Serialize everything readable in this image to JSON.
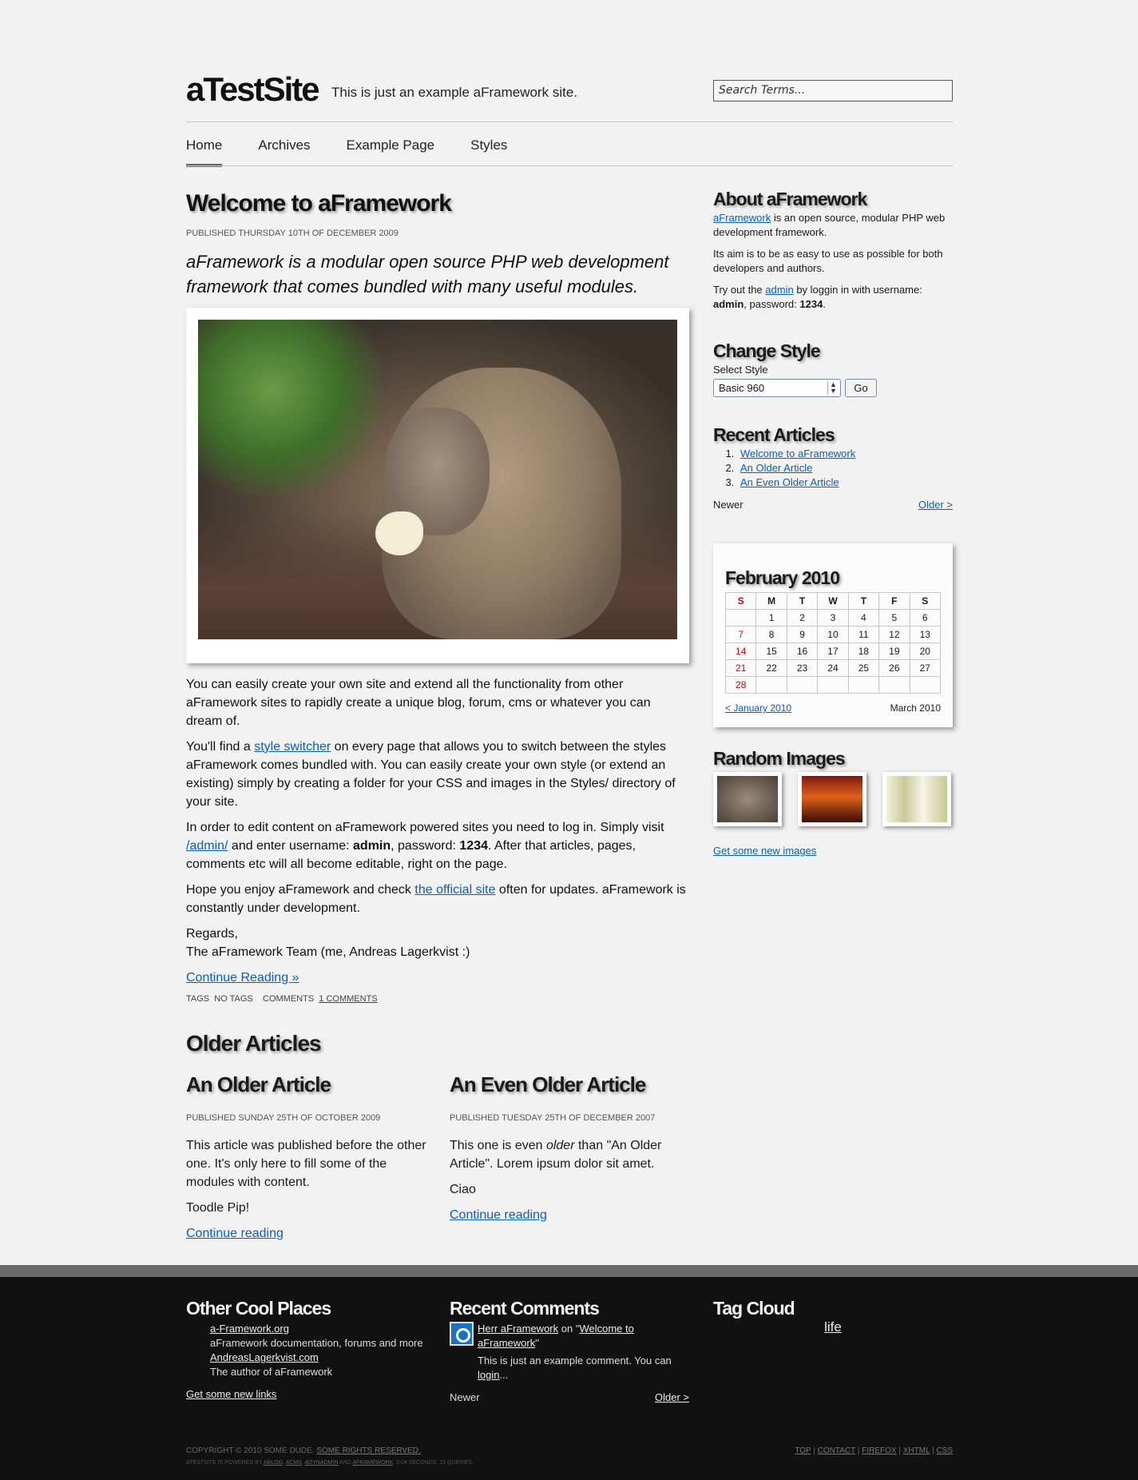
{
  "header": {
    "site_title": "aTestSite",
    "tagline": "This is just an example aFramework site.",
    "search_placeholder": "Search Terms..."
  },
  "nav": [
    {
      "label": "Home",
      "active": true
    },
    {
      "label": "Archives"
    },
    {
      "label": "Example Page"
    },
    {
      "label": "Styles"
    }
  ],
  "article": {
    "title": "Welcome to aFramework",
    "published": "Published Thursday 10th of December 2009",
    "lead": "aFramework is a modular open source PHP web development framework that comes bundled with many useful modules.",
    "p1": "You can easily create your own site and extend all the functionality from other aFramework sites to rapidly create a unique blog, forum, cms or whatever you can dream of.",
    "p2_pre": "You'll find a ",
    "p2_link": "style switcher",
    "p2_post": " on every page that allows you to switch between the styles aFramework comes bundled with. You can easily create your own style (or extend an existing) simply by creating a folder for your CSS and images in the Styles/ directory of your site.",
    "p3_pre": "In order to edit content on aFramework powered sites you need to log in. Simply visit ",
    "p3_link": "/admin/",
    "p3_mid1": " and enter username: ",
    "p3_user": "admin",
    "p3_mid2": ", password: ",
    "p3_pass": "1234",
    "p3_post": ". After that articles, pages, comments etc will all become editable, right on the page.",
    "p4_pre": "Hope you enjoy aFramework and check ",
    "p4_link": "the official site",
    "p4_post": " often for updates. aFramework is constantly under development.",
    "regards": "Regards,",
    "signature": "The aFramework Team (me, Andreas Lagerkvist :)",
    "continue": "Continue Reading »",
    "tags_label": "Tags",
    "tags_value": "No tags",
    "comments_label": "Comments",
    "comments_link": "1 comments"
  },
  "older": {
    "heading": "Older Articles",
    "articles": [
      {
        "title": "An Older Article",
        "published": "Published Sunday 25th of October 2009",
        "p1": "This article was published before the other one. It's only here to fill some of the modules with content.",
        "p2": "Toodle Pip!",
        "continue": "Continue reading"
      },
      {
        "title": "An Even Older Article",
        "published": "Published Tuesday 25th of December 2007",
        "p1_pre": "This one is even ",
        "p1_em": "older",
        "p1_post": " than \"An Older Article\". Lorem ipsum dolor sit amet.",
        "p2": "Ciao",
        "continue": "Continue reading"
      }
    ]
  },
  "sidebar": {
    "about": {
      "heading": "About aFramework",
      "link": "aFramework",
      "p1_post": " is an open source, modular PHP web development framework.",
      "p2": "Its aim is to be as easy to use as possible for both developers and authors.",
      "p3_pre": "Try out the ",
      "p3_link": "admin",
      "p3_mid": " by loggin in with username: ",
      "p3_user": "admin",
      "p3_mid2": ", password: ",
      "p3_pass": "1234",
      "p3_post": "."
    },
    "style": {
      "heading": "Change Style",
      "label": "Select Style",
      "selected": "Basic 960",
      "button": "Go"
    },
    "recent": {
      "heading": "Recent Articles",
      "items": [
        "Welcome to aFramework",
        "An Older Article",
        "An Even Older Article"
      ],
      "newer": "Newer",
      "older": "Older >"
    },
    "calendar": {
      "heading": "February 2010",
      "days": [
        "S",
        "M",
        "T",
        "W",
        "T",
        "F",
        "S"
      ],
      "weeks": [
        [
          "",
          "1",
          "2",
          "3",
          "4",
          "5",
          "6"
        ],
        [
          "7",
          "8",
          "9",
          "10",
          "11",
          "12",
          "13"
        ],
        [
          "14",
          "15",
          "16",
          "17",
          "18",
          "19",
          "20"
        ],
        [
          "21",
          "22",
          "23",
          "24",
          "25",
          "26",
          "27"
        ],
        [
          "28",
          "",
          "",
          "",
          "",
          "",
          ""
        ]
      ],
      "prev": "< January 2010",
      "next": "March 2010"
    },
    "images": {
      "heading": "Random Images",
      "link": "Get some new images"
    }
  },
  "footer": {
    "places": {
      "heading": "Other Cool Places",
      "items": [
        {
          "link": "a-Framework.org",
          "desc": "aFramework documentation, forums and more"
        },
        {
          "link": "AndreasLagerkvist.com",
          "desc": "The author of aFramework"
        }
      ],
      "more": "Get some new links"
    },
    "comments": {
      "heading": "Recent Comments",
      "author": "Herr aFramework",
      "on": " on \"",
      "article": "Welcome to aFramework",
      "close": "\"",
      "text": "This is just an example comment. You can ",
      "text_link": "login",
      "text_post": "...",
      "newer": "Newer",
      "older": "Older >"
    },
    "tags": {
      "heading": "Tag Cloud",
      "tag": "life"
    },
    "copyright": "Copyright © 2010 Some Dude. ",
    "rights": "Some rights reserved.",
    "powered_pre": "aTestSite is powered by ",
    "powered_1": "aBlog",
    "powered_2": "aCMS",
    "powered_3": "aDynAdmin",
    "powered_and": " and ",
    "powered_4": "aFramework",
    "powered_post": ". 0.04 seconds, 13 queries.",
    "links": [
      "Top",
      "Contact",
      "Firefox",
      "XHTML",
      "CSS"
    ]
  }
}
